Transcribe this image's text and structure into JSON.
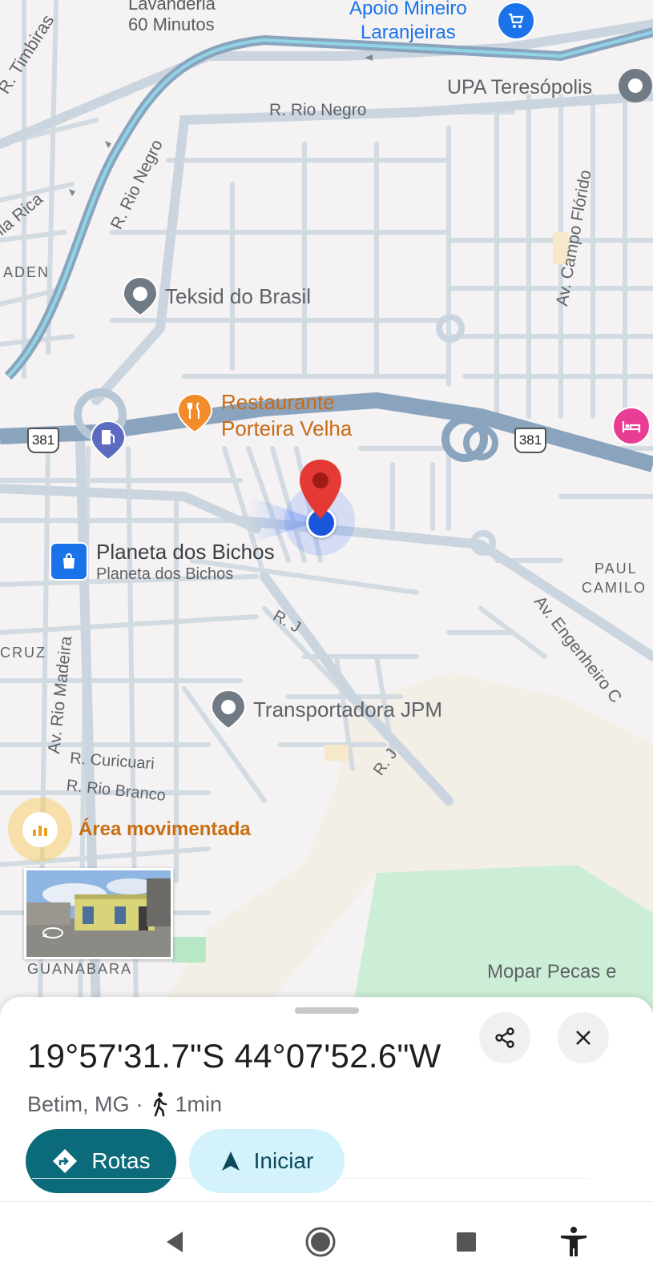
{
  "map": {
    "top_labels": {
      "lavanderia_line1": "Lavanderia",
      "lavanderia_line2": "60 Minutos",
      "apoio_line1": "Apoio Mineiro",
      "apoio_line2": "Laranjeiras",
      "upa": "UPA Teresópolis",
      "timbiras": "R. Timbiras",
      "rio_negro_h": "R. Rio Negro",
      "rio_negro_v": "R. Rio Negro",
      "vila_rica": "Vila Rica",
      "aden": "ADEN",
      "campo_florido": "Av. Campo Flórido"
    },
    "pois": {
      "teksid": "Teksid do Brasil",
      "restaurante_line1": "Restaurante",
      "restaurante_line2": "Porteira Velha",
      "planeta_title": "Planeta dos Bichos",
      "planeta_sub": "Planeta dos Bichos",
      "transportadora": "Transportadora JPM",
      "area": "Área movimentada",
      "mopar": "Mopar Pecas e"
    },
    "streets": {
      "rj1": "R. J",
      "rj2": "R. J",
      "rio_madeira": "Av. Rio Madeira",
      "curicuari": "R. Curicuari",
      "rio_branco": "R. Rio Branco",
      "cruz": "CRUZ",
      "paul": "PAUL",
      "camilo": "CAMILO",
      "engenheiro": "Av. Engenheiro C",
      "guanabara": "GUANABARA"
    },
    "shields": {
      "left": "381",
      "right": "381"
    },
    "colors": {
      "road": "#c9d3dd",
      "highway": "#8aa4be",
      "marker": "#e53935",
      "location": "#1a56db"
    }
  },
  "place_sheet": {
    "coordinates": "19°57'31.7\"S 44°07'52.6\"W",
    "locality": "Betim, MG",
    "separator": "·",
    "walk_time": "1min",
    "actions": {
      "directions_label": "Rotas",
      "start_label": "Iniciar"
    },
    "colors": {
      "directions_bg": "#0b6b7a",
      "start_bg": "#d3f2fb"
    }
  },
  "icons": {
    "share": "share-icon",
    "close": "close-icon",
    "walk": "walk-icon",
    "directions": "directions-icon",
    "navigate": "navigation-arrow-icon",
    "back": "back-icon",
    "home": "home-icon",
    "recents": "recents-icon",
    "accessibility": "accessibility-icon"
  }
}
